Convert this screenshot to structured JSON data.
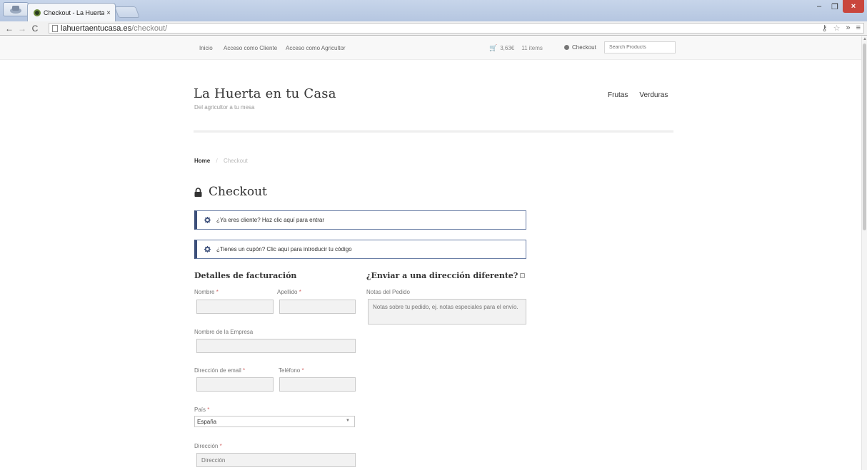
{
  "browser": {
    "tab_title": "Checkout - La Huerta en t",
    "tab_close": "×",
    "url_domain": "lahuertaentucasa.es",
    "url_path": "/checkout/",
    "window_buttons": {
      "minimize": "–",
      "restore": "❐",
      "close": "×"
    }
  },
  "topbar": {
    "links": [
      "Inicio",
      "Acceso como Cliente",
      "Acceso como Agricultor"
    ],
    "cart_total": "3,63€",
    "cart_items": "11 items",
    "checkout_label": "Checkout",
    "search_placeholder": "Search Products"
  },
  "header": {
    "site_title": "La Huerta en tu Casa",
    "site_description": "Del agricultor a tu mesa",
    "nav": [
      "Frutas",
      "Verduras"
    ]
  },
  "breadcrumb": {
    "home": "Home",
    "separator": "/",
    "current": "Checkout"
  },
  "page_title": "Checkout",
  "notices": [
    "¿Ya eres cliente? Haz clic aquí para entrar",
    "¿Tienes un cupón? Clic aquí para introducir tu código"
  ],
  "billing": {
    "title": "Detalles de facturación",
    "required_mark": "*",
    "first_name_label": "Nombre",
    "last_name_label": "Apellido",
    "company_label": "Nombre de la Empresa",
    "email_label": "Dirección de email",
    "phone_label": "Teléfono",
    "country_label": "País",
    "country_value": "España",
    "address_label": "Dirección",
    "address_placeholder": "Dirección"
  },
  "shipping": {
    "title": "¿Enviar a una dirección diferente?",
    "notes_label": "Notas del Pedido",
    "notes_placeholder": "Notas sobre tu pedido, ej. notas especiales para el envío."
  },
  "colors": {
    "notice_border": "#3c4f7a",
    "required": "#d46a6a",
    "close_button": "#c9463d"
  }
}
